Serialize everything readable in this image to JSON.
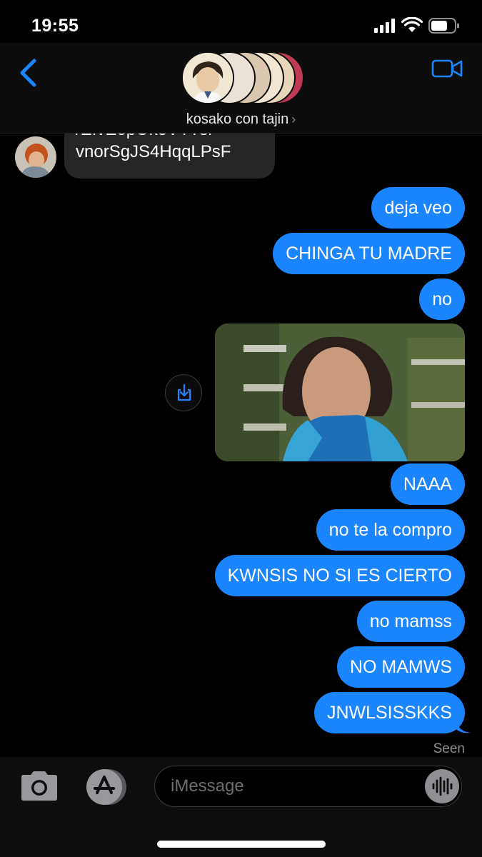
{
  "status_bar": {
    "time": "19:55",
    "icons": [
      "cellular-signal-icon",
      "wifi-icon",
      "battery-icon"
    ]
  },
  "header": {
    "group_name": "kosako con tajin",
    "chevron": "›",
    "back_icon": "chevron-left-icon",
    "video_icon": "video-camera-icon",
    "accent_color": "#1a85ff"
  },
  "messages": {
    "received": [
      {
        "line1": "/EIvEepOkoVY?si=",
        "line2": "vnorSgJS4HqqLPsF"
      }
    ],
    "sent": [
      {
        "text": "deja veo"
      },
      {
        "text": "CHINGA TU MADRE"
      },
      {
        "text": "no"
      },
      {
        "text": "NAAA"
      },
      {
        "text": "no te la compro"
      },
      {
        "text": "KWNSIS NO SI ES CIERTO"
      },
      {
        "text": "no mamss"
      },
      {
        "text": "NO MAMWS"
      },
      {
        "text": "JNWLSISSKKS"
      }
    ],
    "media": {
      "type": "gif-image",
      "save_icon": "share-download-icon"
    },
    "read_receipt": "Seen",
    "sent_bubble_color": "#1a85ff",
    "received_bubble_color": "#262628"
  },
  "composer": {
    "placeholder": "iMessage",
    "camera_icon": "camera-icon",
    "apps_icon": "app-store-icon",
    "audio_icon": "audio-waveform-icon"
  }
}
